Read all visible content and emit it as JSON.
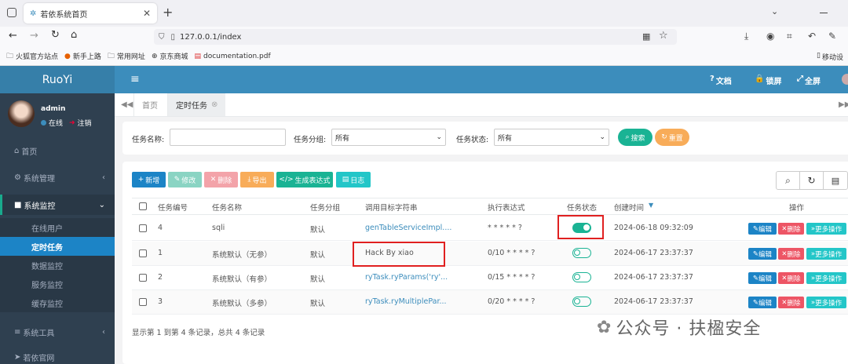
{
  "browser": {
    "tab_title": "若依系统首页",
    "url": "127.0.0.1/index",
    "bookmarks": [
      "火狐官方站点",
      "新手上路",
      "常用网址",
      "京东商城",
      "documentation.pdf"
    ],
    "mobile_bookmarks": "移动设"
  },
  "app": {
    "logo": "RuoYi",
    "user": {
      "name": "admin",
      "status": "在线",
      "logout": "注销"
    },
    "header": {
      "docs": "文档",
      "lock": "锁屏",
      "fullscreen": "全屏"
    },
    "menu": {
      "home": "首页",
      "system_admin": "系统管理",
      "monitor": "系统监控",
      "monitor_items": [
        "在线用户",
        "定时任务",
        "数据监控",
        "服务监控",
        "缓存监控"
      ],
      "tools": "系统工具",
      "official": "若依官网"
    },
    "page_tabs": {
      "home": "首页",
      "current": "定时任务"
    },
    "search": {
      "name_label": "任务名称:",
      "group_label": "任务分组:",
      "group_value": "所有",
      "status_label": "任务状态:",
      "status_value": "所有",
      "search_btn": "搜索",
      "reset_btn": "重置"
    },
    "toolbar": {
      "add": "新增",
      "edit": "修改",
      "delete": "删除",
      "export": "导出",
      "cron": "生成表达式",
      "log": "日志"
    },
    "table": {
      "headers": [
        "任务编号",
        "任务名称",
        "任务分组",
        "调用目标字符串",
        "执行表达式",
        "任务状态",
        "创建时间",
        "操作"
      ],
      "rows": [
        {
          "id": "4",
          "name": "sqli",
          "group": "默认",
          "target": "genTableServiceImpl....",
          "cron": "* * * * * ?",
          "status": "on",
          "created": "2024-06-18 09:32:09"
        },
        {
          "id": "1",
          "name": "系统默认（无参）",
          "group": "默认",
          "target": "Hack By xiao",
          "cron": "0/10 * * * * ?",
          "status": "off",
          "created": "2024-06-17 23:37:37"
        },
        {
          "id": "2",
          "name": "系统默认（有参）",
          "group": "默认",
          "target": "ryTask.ryParams('ry'...",
          "cron": "0/15 * * * * ?",
          "status": "off",
          "created": "2024-06-17 23:37:37"
        },
        {
          "id": "3",
          "name": "系统默认（多参）",
          "group": "默认",
          "target": "ryTask.ryMultiplePar...",
          "cron": "0/20 * * * * ?",
          "status": "off",
          "created": "2024-06-17 23:37:37"
        }
      ],
      "actions": {
        "edit": "编辑",
        "delete": "删除",
        "more": "更多操作"
      },
      "footer": "显示第 1 到第 4 条记录，总共 4 条记录"
    },
    "watermark": "公众号 · 扶楹安全"
  }
}
